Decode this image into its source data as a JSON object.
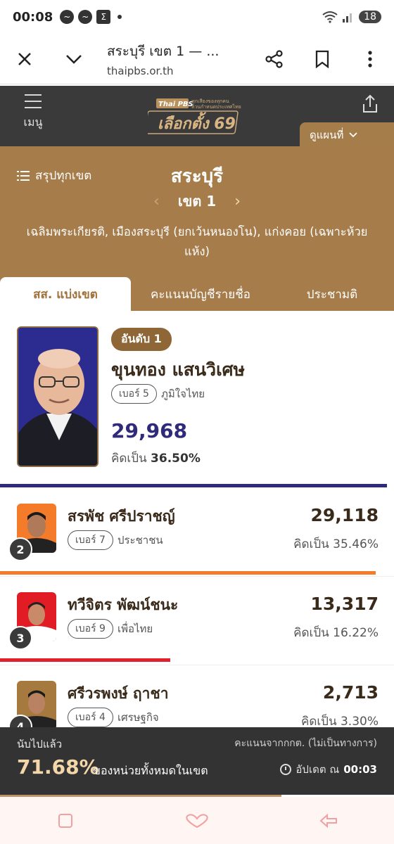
{
  "status_bar": {
    "time": "00:08",
    "battery": "18"
  },
  "browser": {
    "page_title": "สระบุรี เขต 1 — ...",
    "url": "thaipbs.or.th"
  },
  "site_header": {
    "menu_label": "เมนู",
    "logo_brand": "Thai PBS",
    "logo_title": "เลือกตั้ง 69",
    "logo_tagline": "ทุกเสียงของทุกคน ล้วนกำหนดประเทศไทย",
    "map_dropdown": "ดูแผนที่"
  },
  "district": {
    "summary_link": "สรุปทุกเขต",
    "province": "สระบุรี",
    "district_label": "เขต 1",
    "areas": "เฉลิมพระเกียรติ, เมืองสระบุรี (ยกเว้นหนองโน), แก่งคอย (เฉพาะห้วยแห้ง)"
  },
  "tabs": [
    {
      "label": "สส. แบ่งเขต",
      "active": true
    },
    {
      "label": "คะแนนบัญชีรายชื่อ",
      "active": false
    },
    {
      "label": "ประชามติ",
      "active": false
    }
  ],
  "winner": {
    "rank_label": "อันดับ 1",
    "name": "ขุนทอง แสนวิเศษ",
    "number": "เบอร์ 5",
    "party": "ภูมิใจไทย",
    "votes": "29,968",
    "pct_prefix": "คิดเป็น",
    "pct": "36.50%",
    "bar_color": "#2f2a7a",
    "bar_fraction": 1.0
  },
  "candidates": [
    {
      "rank": "2",
      "name": "สรพัช ศรีปราชญ์",
      "number": "เบอร์ 7",
      "party": "ประชาชน",
      "votes": "29,118",
      "pct": "คิดเป็น 35.46%",
      "bar_color": "#f47b2a",
      "bar_fraction": 0.97
    },
    {
      "rank": "3",
      "name": "ทวีจิตร พัฒน์ชนะ",
      "number": "เบอร์ 9",
      "party": "เพื่อไทย",
      "votes": "13,317",
      "pct": "คิดเป็น 16.22%",
      "bar_color": "#e0202a",
      "bar_fraction": 0.44
    },
    {
      "rank": "4",
      "name": "ศรีวรพงษ์ ฤาชา",
      "number": "เบอร์ 4",
      "party": "เศรษฐกิจ",
      "votes": "2,713",
      "pct": "คิดเป็น 3.30%",
      "bar_color": "#e0202a",
      "bar_fraction": 0.09
    }
  ],
  "counted": {
    "label": "นับไปแล้ว",
    "source": "คะแนนจากกกต. (ไม่เป็นทางการ)",
    "percent": "71.68%",
    "suffix": "ของหน่วยทั้งหมดในเขต",
    "updated_prefix": "อัปเดต ณ",
    "updated_time": "00:03"
  }
}
